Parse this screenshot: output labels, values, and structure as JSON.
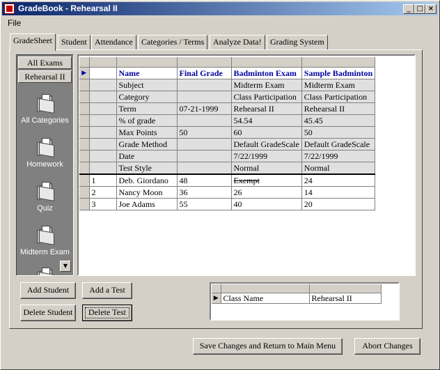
{
  "window": {
    "title": "GradeBook - Rehearsal II"
  },
  "menu": {
    "file": "File"
  },
  "tabs": [
    "GradeSheet",
    "Student",
    "Attendance",
    "Categories / Terms",
    "Analyze Data!",
    "Grading System"
  ],
  "sidebar": {
    "all_exams": "All Exams",
    "current_exam": "Rehearsal II",
    "categories": [
      "All Categories",
      "Homework",
      "Quiz",
      "Midterm Exam"
    ]
  },
  "grid": {
    "name_row": [
      "Name",
      "Final Grade",
      "Badminton Exam",
      "Sample Badminton"
    ],
    "meta_rows": [
      [
        "Subject",
        "",
        "Midterm Exam",
        "Midterm Exam"
      ],
      [
        "Category",
        "",
        "Class Participation",
        "Class Participation"
      ],
      [
        "Term",
        "07-21-1999",
        "Rehearsal II",
        "Rehearsal II"
      ],
      [
        "% of grade",
        "",
        "54.54",
        "45.45"
      ],
      [
        "Max Points",
        "50",
        "60",
        "50"
      ],
      [
        "Grade Method",
        "",
        "Default GradeScale",
        "Default GradeScale"
      ],
      [
        "Date",
        "",
        "7/22/1999",
        "7/22/1999"
      ],
      [
        "Test Style",
        "",
        "Normal",
        "Normal"
      ]
    ],
    "students": [
      [
        "1",
        "Deb. Giordano",
        "48",
        "Exempt",
        "24"
      ],
      [
        "2",
        "Nancy Moon",
        "36",
        "26",
        "14"
      ],
      [
        "3",
        "Joe Adams",
        "55",
        "40",
        "20"
      ]
    ]
  },
  "buttons": {
    "add_student": "Add Student",
    "add_test": "Add a Test",
    "delete_student": "Delete Student",
    "delete_test": "Delete Test",
    "save_return": "Save Changes and Return to Main Menu",
    "abort": "Abort Changes"
  },
  "class_info": {
    "label": "Class Name",
    "value": "Rehearsal II"
  }
}
